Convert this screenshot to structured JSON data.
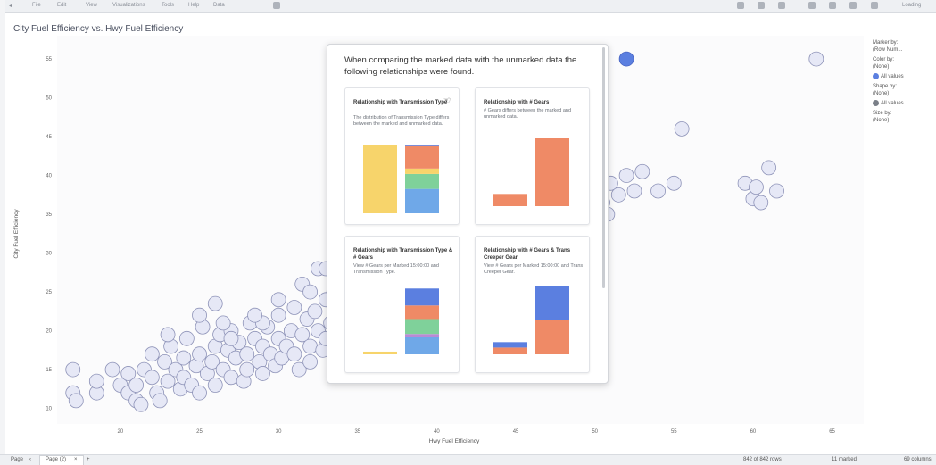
{
  "toolbar": {
    "menus": [
      "File",
      "Edit",
      "View",
      "Visualizations",
      "Tools",
      "Help",
      "Data"
    ],
    "right_label": "Loading"
  },
  "chart": {
    "title": "City Fuel Efficiency vs. Hwy Fuel Efficiency",
    "xlabel": "Hwy Fuel Efficiency",
    "ylabel": "City Fuel Efficiency"
  },
  "chart_data": {
    "type": "scatter",
    "title": "City Fuel Efficiency vs. Hwy Fuel Efficiency",
    "xlabel": "Hwy Fuel Efficiency",
    "ylabel": "City Fuel Efficiency",
    "xlim": [
      16,
      67
    ],
    "ylim": [
      8,
      58
    ],
    "xticks": [
      20,
      25,
      30,
      35,
      40,
      45,
      50,
      55,
      60,
      65
    ],
    "yticks": [
      10,
      15,
      20,
      25,
      30,
      35,
      40,
      45,
      50,
      55
    ],
    "marked_points": [
      [
        52,
        55
      ]
    ],
    "points": [
      [
        17,
        15
      ],
      [
        17,
        12
      ],
      [
        17.2,
        11
      ],
      [
        18.5,
        12
      ],
      [
        18.5,
        13.5
      ],
      [
        19.5,
        15
      ],
      [
        20,
        13
      ],
      [
        20.5,
        14.5
      ],
      [
        20.5,
        12
      ],
      [
        21,
        11
      ],
      [
        21,
        13
      ],
      [
        21.3,
        10.5
      ],
      [
        21.5,
        15
      ],
      [
        22,
        17
      ],
      [
        22,
        14
      ],
      [
        22.3,
        12
      ],
      [
        22.5,
        11
      ],
      [
        22.8,
        16
      ],
      [
        23,
        13.5
      ],
      [
        23.2,
        18
      ],
      [
        23.5,
        15
      ],
      [
        23.8,
        12.5
      ],
      [
        24,
        16.5
      ],
      [
        24,
        14
      ],
      [
        24.2,
        19
      ],
      [
        24.5,
        13
      ],
      [
        24.8,
        15.5
      ],
      [
        25,
        17
      ],
      [
        25,
        12
      ],
      [
        25.2,
        20.5
      ],
      [
        25.5,
        14.5
      ],
      [
        25.8,
        16
      ],
      [
        26,
        18
      ],
      [
        26,
        13
      ],
      [
        26.3,
        19.5
      ],
      [
        26.5,
        15
      ],
      [
        26.8,
        17.5
      ],
      [
        27,
        14
      ],
      [
        27,
        20
      ],
      [
        27.3,
        16.5
      ],
      [
        27.5,
        18.5
      ],
      [
        27.8,
        13.5
      ],
      [
        28,
        17
      ],
      [
        28,
        15
      ],
      [
        28.2,
        21
      ],
      [
        28.5,
        19
      ],
      [
        28.8,
        16
      ],
      [
        29,
        18
      ],
      [
        29,
        14.5
      ],
      [
        29.3,
        20.5
      ],
      [
        29.5,
        17
      ],
      [
        29.8,
        15.5
      ],
      [
        30,
        19
      ],
      [
        30,
        22
      ],
      [
        30.2,
        16.5
      ],
      [
        30.5,
        18
      ],
      [
        30.8,
        20
      ],
      [
        31,
        17
      ],
      [
        31,
        23
      ],
      [
        31.3,
        15
      ],
      [
        31.5,
        19.5
      ],
      [
        31.8,
        21.5
      ],
      [
        32,
        18
      ],
      [
        32,
        16
      ],
      [
        32.3,
        22.5
      ],
      [
        32.5,
        20
      ],
      [
        32.8,
        17.5
      ],
      [
        33,
        24
      ],
      [
        33,
        19
      ],
      [
        33.3,
        21
      ],
      [
        33.5,
        25
      ],
      [
        33.8,
        18.5
      ],
      [
        34,
        22
      ],
      [
        34,
        27
      ],
      [
        31.5,
        26
      ],
      [
        32,
        25
      ],
      [
        29,
        21
      ],
      [
        28.5,
        22
      ],
      [
        26.5,
        21
      ],
      [
        25,
        22
      ],
      [
        26,
        23.5
      ],
      [
        27,
        19
      ],
      [
        23,
        19.5
      ],
      [
        30,
        24
      ],
      [
        32.5,
        28
      ],
      [
        33,
        28
      ],
      [
        48.5,
        32
      ],
      [
        48.5,
        35
      ],
      [
        49,
        37
      ],
      [
        49.5,
        36
      ],
      [
        50,
        38
      ],
      [
        50.5,
        36.5
      ],
      [
        50.8,
        35
      ],
      [
        51,
        39
      ],
      [
        51.5,
        37.5
      ],
      [
        52,
        40
      ],
      [
        52.5,
        38
      ],
      [
        53,
        40.5
      ],
      [
        54,
        38
      ],
      [
        55,
        39
      ],
      [
        55.5,
        46
      ],
      [
        50,
        29.5
      ],
      [
        48,
        29
      ],
      [
        59.5,
        39
      ],
      [
        60,
        37
      ],
      [
        60.2,
        38.5
      ],
      [
        61,
        41
      ],
      [
        61.5,
        38
      ],
      [
        60.5,
        36.5
      ],
      [
        64,
        55
      ]
    ]
  },
  "legend": {
    "marker_by_label": "Marker by:",
    "marker_by_value": "(Row Num...",
    "color_by_label": "Color by:",
    "color_by_value": "(None)",
    "color_item": "All values",
    "shape_by_label": "Shape by:",
    "shape_by_value": "(None)",
    "shape_item": "All values",
    "size_by_label": "Size by:",
    "size_by_value": "(None)",
    "color_swatch": "#5b7fe0",
    "shape_swatch": "#7a7f88"
  },
  "popup": {
    "heading": "When comparing the marked data with the unmarked data the following relationships were found.",
    "cards": [
      {
        "title": "Relationship with Transmission Type",
        "desc": "The distribution of Transmission Type differs between the marked and unmarked data.",
        "bars": [
          {
            "segments": [
              {
                "v": 1,
                "c": "#f7d46b"
              }
            ]
          },
          {
            "segments": [
              {
                "v": 0.36,
                "c": "#6fa8e8"
              },
              {
                "v": 0.22,
                "c": "#7fd19a"
              },
              {
                "v": 0.08,
                "c": "#f7d46b"
              },
              {
                "v": 0.33,
                "c": "#ef8a66"
              },
              {
                "v": 0.01,
                "c": "#5b7fe0"
              }
            ]
          }
        ]
      },
      {
        "title": "Relationship with # Gears",
        "desc": "# Gears differs between the marked and unmarked data.",
        "bars": [
          {
            "segments": [
              {
                "v": 0.18,
                "c": "#ef8a66"
              }
            ]
          },
          {
            "segments": [
              {
                "v": 1,
                "c": "#ef8a66"
              }
            ]
          }
        ]
      },
      {
        "title": "Relationship with Transmission Type & # Gears",
        "desc": "View # Gears per Marked 15:00:00 and Transmission Type.",
        "bars": [
          {
            "segments": [
              {
                "v": 0.04,
                "c": "#f7d46b"
              }
            ]
          },
          {
            "segments": [
              {
                "v": 0.25,
                "c": "#6fa8e8"
              },
              {
                "v": 0.05,
                "c": "#b98ad6"
              },
              {
                "v": 0.22,
                "c": "#7fd19a"
              },
              {
                "v": 0.2,
                "c": "#ef8a66"
              },
              {
                "v": 0.25,
                "c": "#5b7fe0"
              }
            ]
          }
        ]
      },
      {
        "title": "Relationship with # Gears & Trans Creeper Gear",
        "desc": "View # Gears per Marked 15:00:00 and Trans Creeper Gear.",
        "bars": [
          {
            "segments": [
              {
                "v": 0.1,
                "c": "#ef8a66"
              },
              {
                "v": 0.08,
                "c": "#5b7fe0"
              }
            ]
          },
          {
            "segments": [
              {
                "v": 0.5,
                "c": "#ef8a66"
              },
              {
                "v": 0.5,
                "c": "#5b7fe0"
              }
            ]
          }
        ]
      }
    ]
  },
  "status": {
    "page_label": "Page",
    "page_tab": "Page (2)",
    "rows": "842 of 842 rows",
    "marked": "11 marked",
    "columns": "69 columns"
  }
}
